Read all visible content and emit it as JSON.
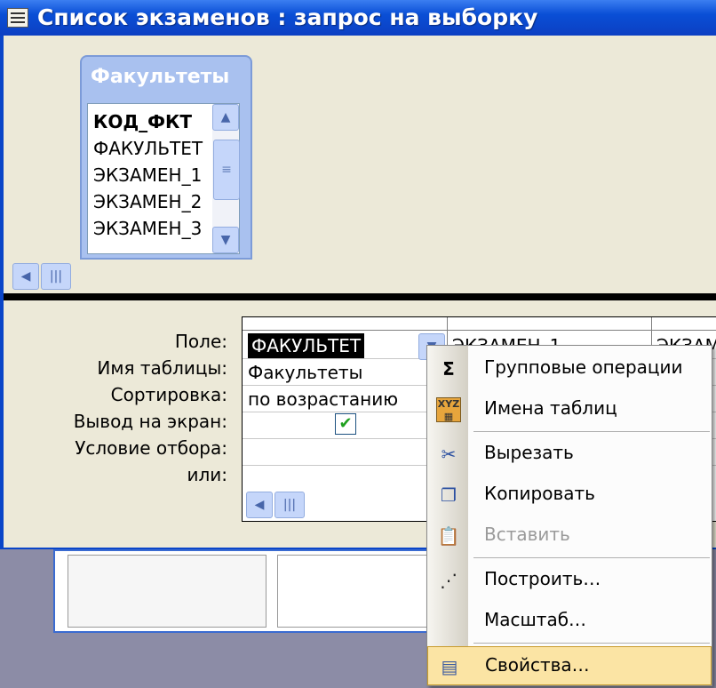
{
  "window": {
    "title": "Список экзаменов : запрос на выборку"
  },
  "table": {
    "title": "Факультеты",
    "fields": [
      "КОД_ФКТ",
      "ФАКУЛЬТЕТ",
      "ЭКЗАМЕН_1",
      "ЭКЗАМЕН_2",
      "ЭКЗАМЕН_3"
    ]
  },
  "grid": {
    "row_labels": [
      "Поле:",
      "Имя таблицы:",
      "Сортировка:",
      "Вывод на экран:",
      "Условие отбора:",
      "или:"
    ],
    "col1": {
      "field": "ФАКУЛЬТЕТ",
      "table": "Факультеты",
      "sort": "по возрастанию",
      "show_checked": true
    },
    "col2": {
      "field": "ЭКЗАМЕН_1"
    },
    "col3": {
      "field": "ЭКЗАМ"
    }
  },
  "menu": {
    "items": [
      {
        "label": "Групповые операции",
        "icon": "sigma-icon"
      },
      {
        "label": "Имена таблиц",
        "icon": "table-names-icon"
      },
      {
        "label": "Вырезать",
        "icon": "scissors-icon"
      },
      {
        "label": "Копировать",
        "icon": "copy-icon"
      },
      {
        "label": "Вставить",
        "icon": "paste-icon",
        "disabled": true
      },
      {
        "label": "Построить…",
        "icon": "build-wand-icon"
      },
      {
        "label": "Масштаб…",
        "icon": ""
      },
      {
        "label": "Свойства…",
        "icon": "properties-icon",
        "highlighted": true
      }
    ]
  },
  "colors": {
    "titlebar": "#0a4fd6",
    "menu_highlight": "#fbe4a4",
    "table_header": "#a9c1ef"
  }
}
